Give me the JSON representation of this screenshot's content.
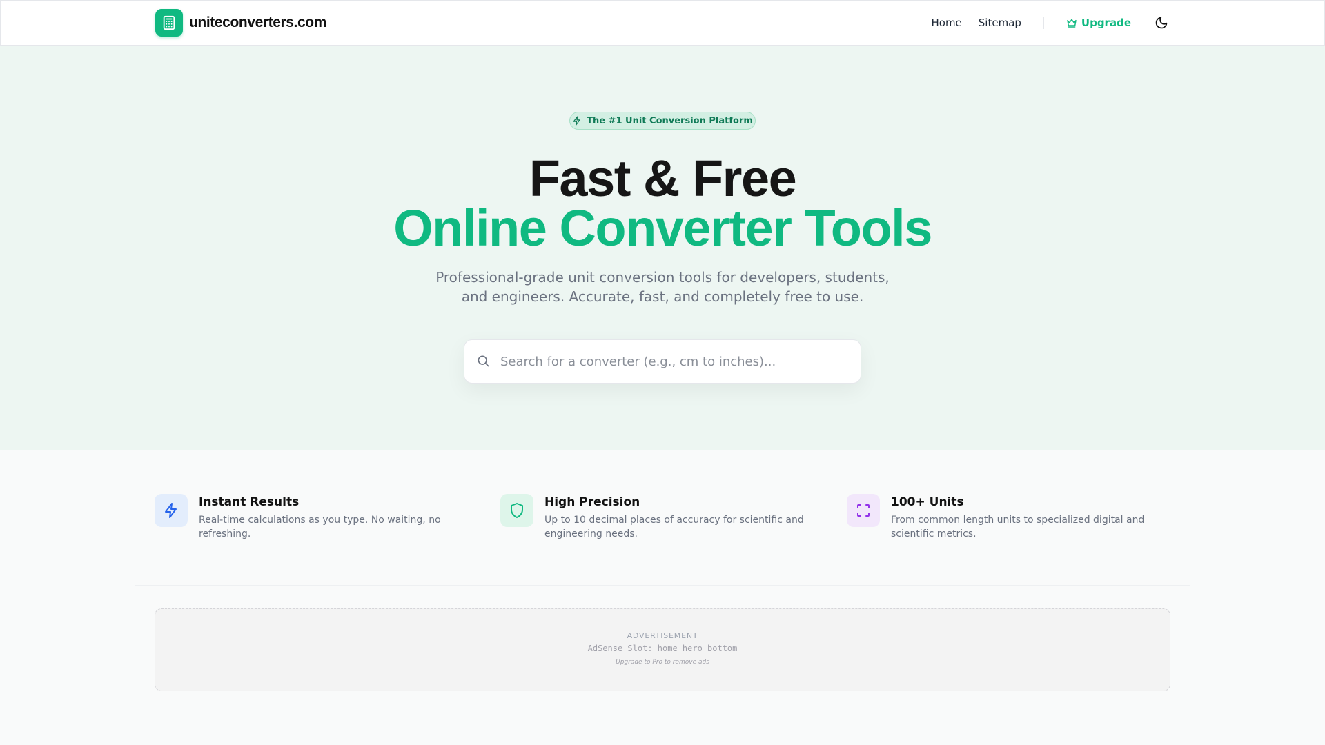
{
  "header": {
    "brand": "uniteconverters.com",
    "nav": [
      {
        "label": "Home"
      },
      {
        "label": "Sitemap"
      }
    ],
    "upgrade_label": "Upgrade"
  },
  "hero": {
    "badge": "The #1 Unit Conversion Platform",
    "title_line1": "Fast & Free",
    "title_line2": "Online Converter Tools",
    "subtitle": "Professional-grade unit conversion tools for developers, students, and engineers. Accurate, fast, and completely free to use.",
    "search_placeholder": "Search for a converter (e.g., cm to inches)...",
    "search_value": ""
  },
  "features": [
    {
      "title": "Instant Results",
      "desc": "Real-time calculations as you type. No waiting, no refreshing.",
      "icon": "lightning-icon",
      "color": "#2563eb",
      "bg": "#e3edfc"
    },
    {
      "title": "High Precision",
      "desc": "Up to 10 decimal places of accuracy for scientific and engineering needs.",
      "icon": "shield-icon",
      "color": "#10b981",
      "bg": "#def5ea"
    },
    {
      "title": "100+ Units",
      "desc": "From common length units to specialized digital and scientific metrics.",
      "icon": "scan-icon",
      "color": "#9333ea",
      "bg": "#f2e7fb"
    }
  ],
  "ad": {
    "label": "ADVERTISEMENT",
    "slot": "AdSense Slot: home_hero_bottom",
    "note": "Upgrade to Pro to remove ads"
  },
  "colors": {
    "accent": "#10b981",
    "hero_bg": "#edf6f2",
    "page_bg": "#f9fafa"
  }
}
